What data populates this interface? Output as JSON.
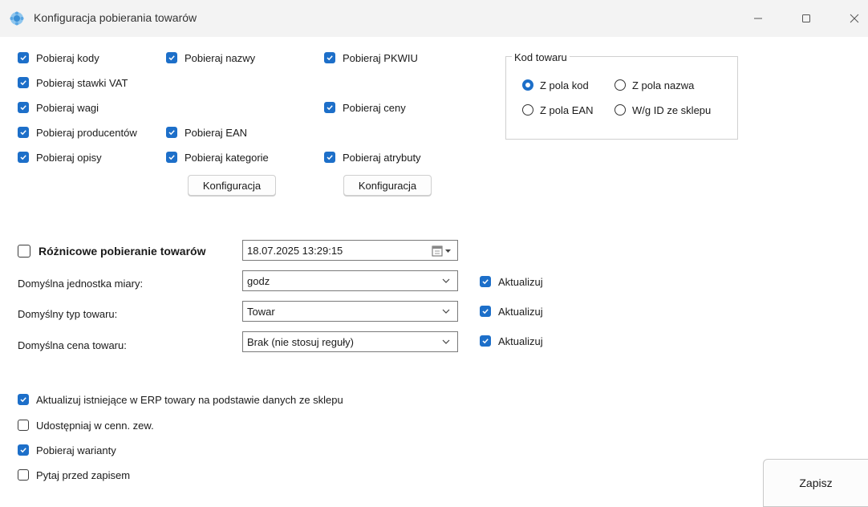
{
  "window": {
    "title": "Konfiguracja pobierania towarów"
  },
  "options": {
    "codes": {
      "label": "Pobieraj kody",
      "checked": true
    },
    "names": {
      "label": "Pobieraj nazwy",
      "checked": true
    },
    "pkwiu": {
      "label": "Pobieraj PKWIU",
      "checked": true
    },
    "vat": {
      "label": "Pobieraj stawki VAT",
      "checked": true
    },
    "weights": {
      "label": "Pobieraj wagi",
      "checked": true
    },
    "prices": {
      "label": "Pobieraj ceny",
      "checked": true
    },
    "producers": {
      "label": "Pobieraj producentów",
      "checked": true
    },
    "ean": {
      "label": "Pobieraj EAN",
      "checked": true
    },
    "descriptions": {
      "label": "Pobieraj opisy",
      "checked": true
    },
    "categories": {
      "label": "Pobieraj kategorie",
      "checked": true
    },
    "attributes": {
      "label": "Pobieraj atrybuty",
      "checked": true
    }
  },
  "config_buttons": {
    "categories": "Konfiguracja",
    "attributes": "Konfiguracja"
  },
  "product_code_group": {
    "legend": "Kod towaru",
    "options": [
      {
        "label": "Z pola kod",
        "selected": true
      },
      {
        "label": "Z pola nazwa",
        "selected": false
      },
      {
        "label": "Z pola EAN",
        "selected": false
      },
      {
        "label": "W/g ID ze sklepu",
        "selected": false
      }
    ]
  },
  "differential": {
    "label": "Różnicowe pobieranie towarów",
    "checked": false,
    "datetime": "18.07.2025 13:29:15"
  },
  "defaults": [
    {
      "label": "Domyślna jednostka miary:",
      "value": "godz",
      "update_label": "Aktualizuj",
      "update_checked": true
    },
    {
      "label": "Domyślny typ towaru:",
      "value": "Towar",
      "update_label": "Aktualizuj",
      "update_checked": true
    },
    {
      "label": "Domyślna cena towaru:",
      "value": "Brak (nie stosuj reguły)",
      "update_label": "Aktualizuj",
      "update_checked": true
    }
  ],
  "bottom_options": [
    {
      "label": "Aktualizuj istniejące w ERP towary na podstawie danych ze sklepu",
      "checked": true
    },
    {
      "label": "Udostępniaj w cenn. zew.",
      "checked": false
    },
    {
      "label": "Pobieraj warianty",
      "checked": true
    },
    {
      "label": "Pytaj przed zapisem",
      "checked": false
    }
  ],
  "save_label": "Zapisz"
}
